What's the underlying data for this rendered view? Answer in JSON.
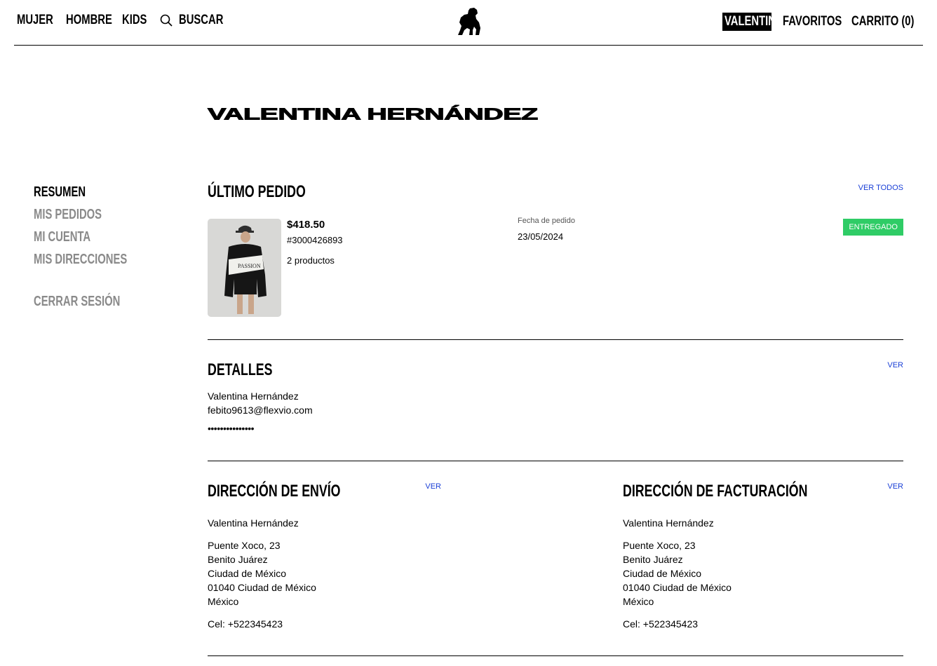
{
  "header": {
    "nav_left": [
      "MUJER",
      "HOMBRE",
      "KIDS"
    ],
    "search_label": "BUSCAR",
    "user_label": "VALENTINA",
    "favorites_label": "FAVORITOS",
    "cart_label": "CARRITO (0)"
  },
  "page": {
    "title": "VALENTINA HERNÁNDEZ"
  },
  "sidebar": {
    "items": [
      {
        "label": "RESUMEN",
        "active": true
      },
      {
        "label": "MIS PEDIDOS",
        "active": false
      },
      {
        "label": "MI CUENTA",
        "active": false
      },
      {
        "label": "MIS DIRECCIONES",
        "active": false
      }
    ],
    "logout_label": "CERRAR SESIÓN"
  },
  "last_order": {
    "title": "ÚLTIMO PEDIDO",
    "view_all_label": "VER TODOS",
    "price": "$418.50",
    "order_number": "#3000426893",
    "quantity": "2 productos",
    "date_label": "Fecha de pedido",
    "date_value": "23/05/2024",
    "status": "ENTREGADO",
    "status_color": "#2fcc66"
  },
  "details": {
    "title": "DETALLES",
    "view_label": "VER",
    "name": "Valentina Hernández",
    "email": "febito9613@flexvio.com",
    "password_mask": "•••••••••••••••"
  },
  "shipping": {
    "title": "DIRECCIÓN DE ENVÍO",
    "view_label": "VER",
    "name": "Valentina Hernández",
    "street": "Puente Xoco, 23",
    "district": "Benito Juárez",
    "city": "Ciudad de México",
    "postal": "01040 Ciudad de México",
    "country": "México",
    "phone": "Cel: +522345423"
  },
  "billing": {
    "title": "DIRECCIÓN DE FACTURACIÓN",
    "view_label": "VER",
    "name": "Valentina Hernández",
    "street": "Puente Xoco, 23",
    "district": "Benito Juárez",
    "city": "Ciudad de México",
    "postal": "01040 Ciudad de México",
    "country": "México",
    "phone": "Cel: +522345423"
  },
  "colors": {
    "link": "#1a3fd6",
    "muted": "#8a8a8a"
  }
}
